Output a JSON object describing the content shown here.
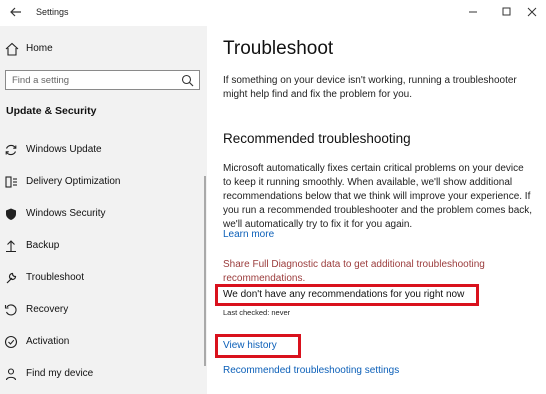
{
  "window": {
    "title": "Settings",
    "controls": {
      "minimize": "minimize-icon",
      "maximize": "maximize-icon",
      "close": "close-icon"
    }
  },
  "sidebar": {
    "home_label": "Home",
    "search": {
      "placeholder": "Find a setting",
      "value": ""
    },
    "section_title": "Update & Security",
    "items": [
      {
        "label": "Windows Update",
        "icon": "sync-icon"
      },
      {
        "label": "Delivery Optimization",
        "icon": "delivery-optimization-icon"
      },
      {
        "label": "Windows Security",
        "icon": "shield-icon"
      },
      {
        "label": "Backup",
        "icon": "backup-icon"
      },
      {
        "label": "Troubleshoot",
        "icon": "wrench-icon"
      },
      {
        "label": "Recovery",
        "icon": "recovery-icon"
      },
      {
        "label": "Activation",
        "icon": "activation-icon"
      },
      {
        "label": "Find my device",
        "icon": "person-icon"
      }
    ]
  },
  "main": {
    "title": "Troubleshoot",
    "intro": "If something on your device isn't working, running a troubleshooter might help find and fix the problem for you.",
    "recommended": {
      "heading": "Recommended troubleshooting",
      "body": "Microsoft automatically fixes certain critical problems on your device to keep it running smoothly. When available, we'll show additional recommendations below that we think will improve your experience. If you run a recommended troubleshooter and the problem comes back, we'll automatically try to fix it for you again.",
      "learn_more": "Learn more",
      "share_link": "Share Full Diagnostic data to get additional troubleshooting recommendations.",
      "status": "We don't have any recommendations for you right now",
      "last_checked": "Last checked: never",
      "view_history": "View history",
      "settings_link": "Recommended troubleshooting settings"
    }
  },
  "colors": {
    "accent": "#0b5fb8",
    "highlight_border": "#d9111d",
    "sidebar_bg": "#f2f2f2",
    "share_link": "#9b3c3c"
  }
}
